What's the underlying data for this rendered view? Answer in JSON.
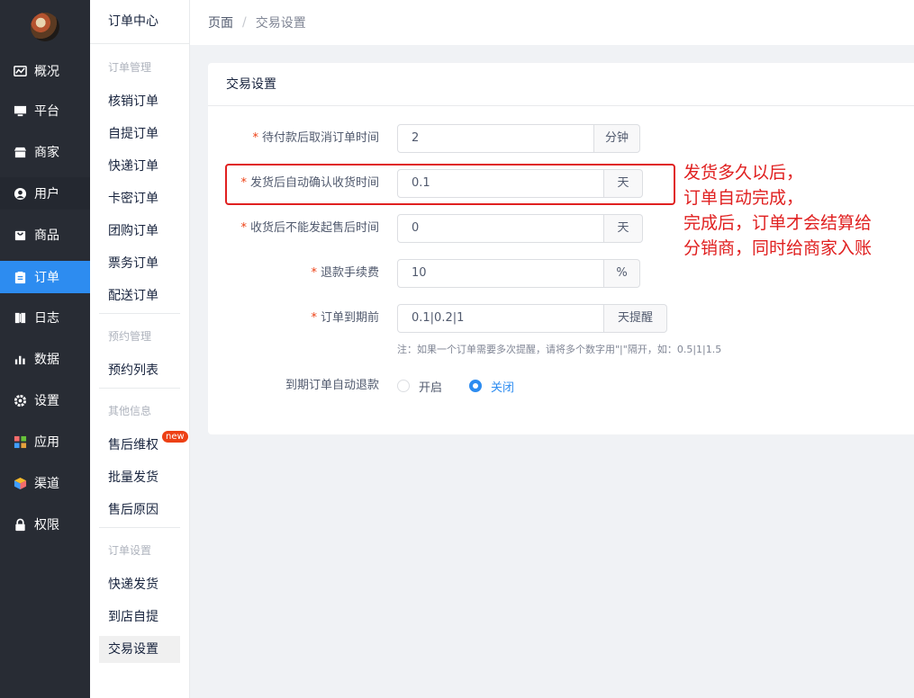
{
  "nav": {
    "items": [
      {
        "label": "概况",
        "icon": "chart-icon"
      },
      {
        "label": "平台",
        "icon": "monitor-icon"
      },
      {
        "label": "商家",
        "icon": "store-icon"
      },
      {
        "label": "用户",
        "icon": "user-icon"
      },
      {
        "label": "商品",
        "icon": "bag-icon"
      },
      {
        "label": "订单",
        "icon": "clipboard-icon"
      },
      {
        "label": "日志",
        "icon": "book-icon"
      },
      {
        "label": "数据",
        "icon": "bar-chart-icon"
      },
      {
        "label": "设置",
        "icon": "gear-icon"
      },
      {
        "label": "应用",
        "icon": "apps-icon"
      },
      {
        "label": "渠道",
        "icon": "cube-icon"
      },
      {
        "label": "权限",
        "icon": "lock-icon"
      }
    ],
    "active": "订单"
  },
  "submenu": {
    "title": "订单中心",
    "groups": {
      "order_mgmt": "订单管理",
      "reservation_mgmt": "预约管理",
      "other_info": "其他信息",
      "order_settings": "订单设置"
    },
    "items": {
      "verify": "核销订单",
      "pickup": "自提订单",
      "express": "快递订单",
      "card": "卡密订单",
      "group": "团购订单",
      "ticket": "票务订单",
      "delivery": "配送订单",
      "reservation_list": "预约列表",
      "after_sale": "售后维权",
      "batch_ship": "批量发货",
      "after_sale_reason": "售后原因",
      "express_ship": "快递发货",
      "store_pickup": "到店自提",
      "trade_settings": "交易设置"
    },
    "new_badge": "new"
  },
  "breadcrumb": {
    "root": "页面",
    "separator": "/",
    "current": "交易设置"
  },
  "card": {
    "title": "交易设置",
    "fields": {
      "cancel": {
        "label": "待付款后取消订单时间",
        "value": "2",
        "unit": "分钟"
      },
      "confirm": {
        "label": "发货后自动确认收货时间",
        "value": "0.1",
        "unit": "天"
      },
      "aftersale": {
        "label": "收货后不能发起售后时间",
        "value": "0",
        "unit": "天"
      },
      "fee": {
        "label": "退款手续费",
        "value": "10",
        "unit": "%"
      },
      "expire": {
        "label": "订单到期前",
        "value": "0.1|0.2|1",
        "unit": "天提醒"
      }
    },
    "note": "注：如果一个订单需要多次提醒，请将多个数字用\"|\"隔开，如：0.5|1|1.5",
    "auto_refund": {
      "label": "到期订单自动退款",
      "on": "开启",
      "off": "关闭",
      "selected": "关闭"
    }
  },
  "annotation": {
    "lines": [
      "发货多久以后，",
      "订单自动完成，",
      "完成后，订单才会结算给",
      "分销商，同时给商家入账"
    ],
    "color": "#e02020"
  },
  "colors": {
    "primary": "#2d8cf0",
    "nav_bg": "#282c34",
    "required": "#ed4014"
  }
}
